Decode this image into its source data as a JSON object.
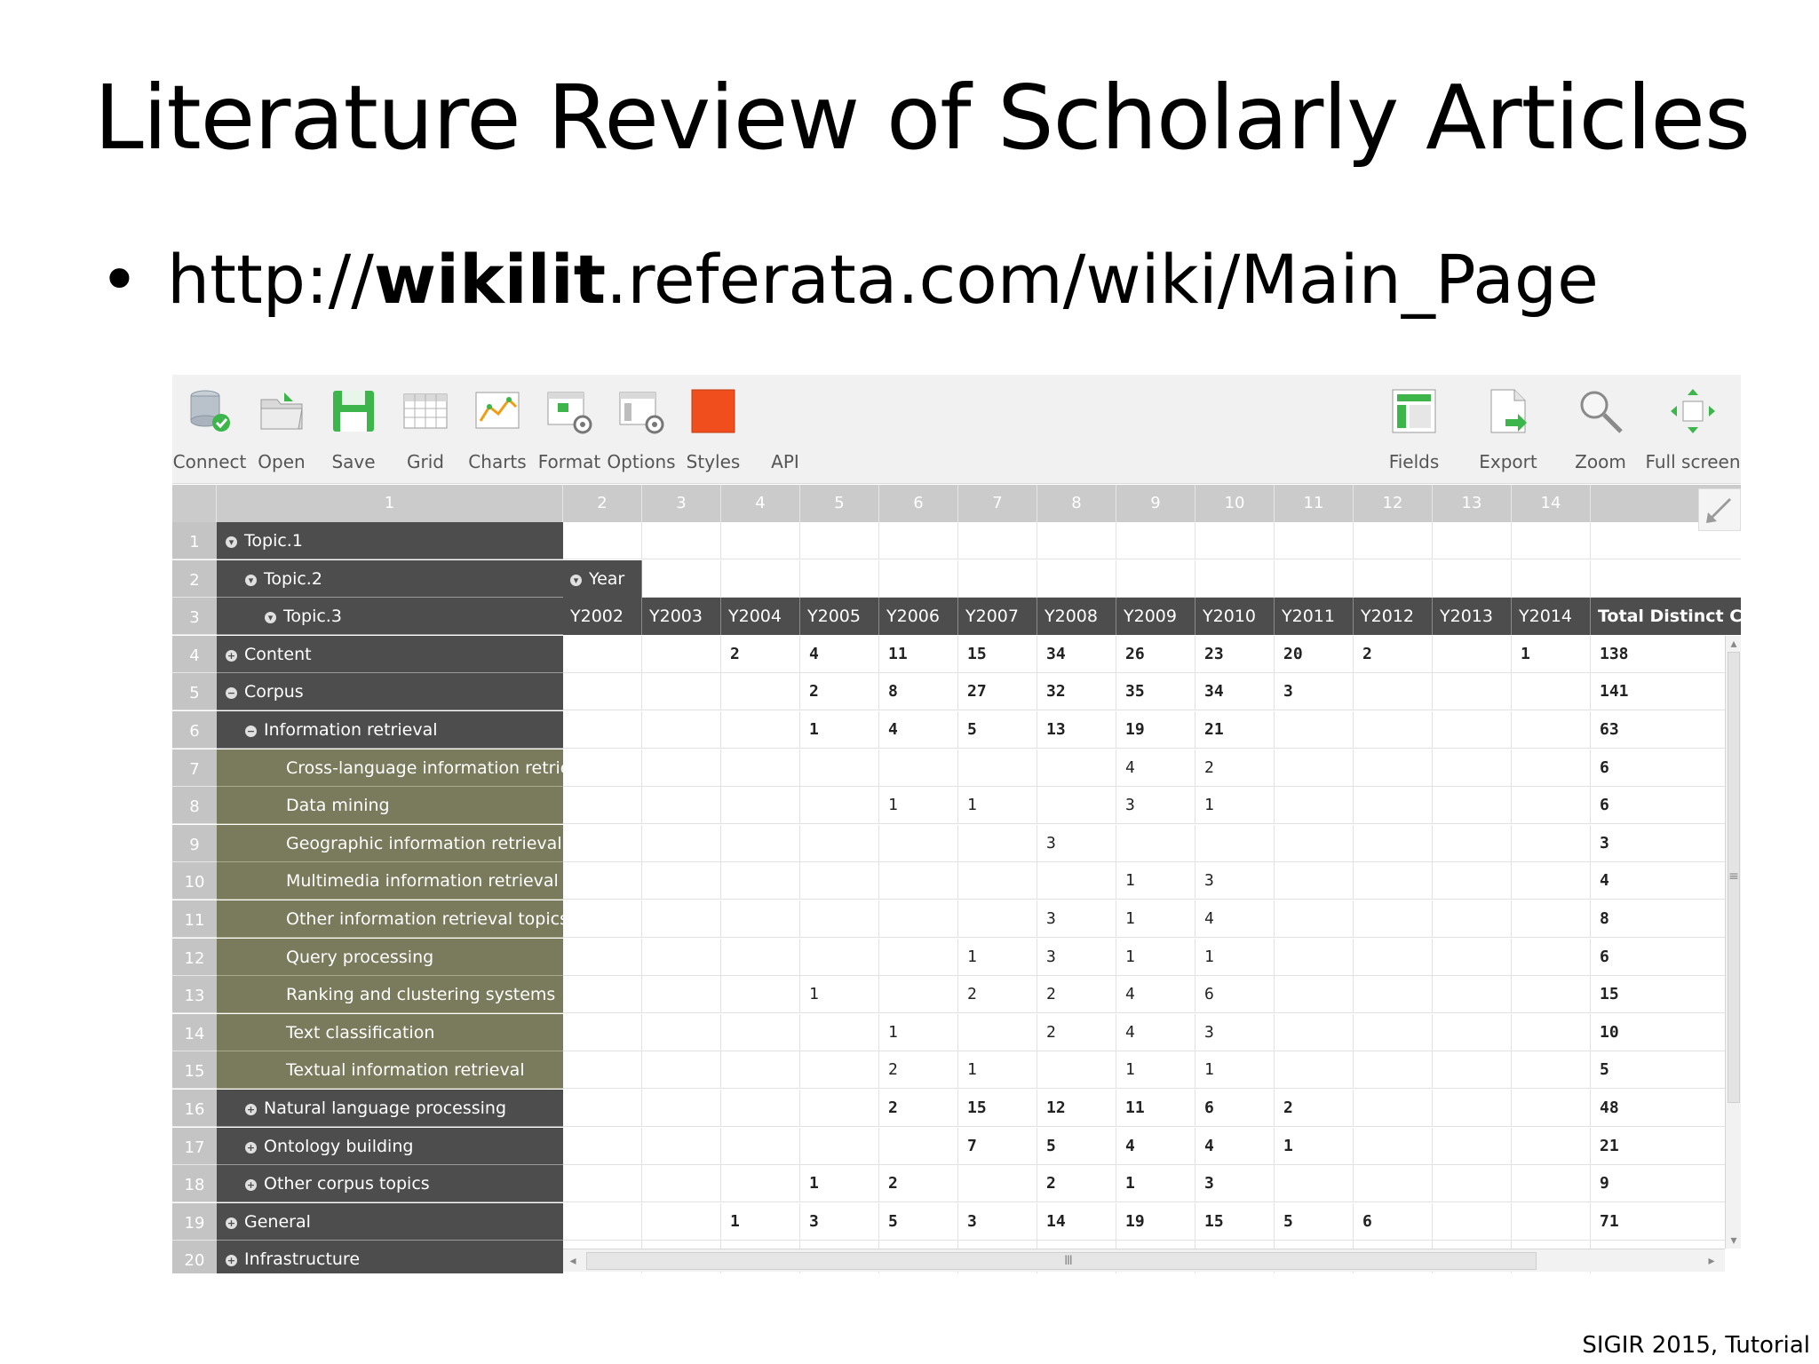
{
  "slide": {
    "title": "Literature Review of Scholarly Articles",
    "bullet": "•",
    "url_prefix": "http://",
    "url_bold": "wikilit",
    "url_suffix": ".referata.com/wiki/Main_Page",
    "footer": "SIGIR 2015, Tutorial"
  },
  "toolbar": {
    "left": [
      {
        "label": "Connect",
        "icon": "database-connect-icon"
      },
      {
        "label": "Open",
        "icon": "folder-open-icon"
      },
      {
        "label": "Save",
        "icon": "floppy-save-icon"
      },
      {
        "label": "Grid",
        "icon": "grid-icon"
      },
      {
        "label": "Charts",
        "icon": "line-chart-icon"
      },
      {
        "label": "Format",
        "icon": "format-cells-icon"
      },
      {
        "label": "Options",
        "icon": "options-gear-icon"
      },
      {
        "label": "Styles",
        "icon": "styles-swatch-icon"
      },
      {
        "label": "API",
        "icon": ""
      }
    ],
    "right": [
      {
        "label": "Fields",
        "icon": "fields-layout-icon"
      },
      {
        "label": "Export",
        "icon": "export-document-icon"
      },
      {
        "label": "Zoom",
        "icon": "magnifier-zoom-icon"
      },
      {
        "label": "Full screen",
        "icon": "fullscreen-arrows-icon"
      }
    ]
  },
  "grid": {
    "column_numbers": [
      "1",
      "2",
      "3",
      "4",
      "5",
      "6",
      "7",
      "8",
      "9",
      "10",
      "11",
      "12",
      "13",
      "14"
    ],
    "hierarchy_labels": [
      "Topic.1",
      "Topic.2",
      "Topic.3"
    ],
    "year_field": "Year",
    "years": [
      "Y2002",
      "Y2003",
      "Y2004",
      "Y2005",
      "Y2006",
      "Y2007",
      "Y2008",
      "Y2009",
      "Y2010",
      "Y2011",
      "Y2012",
      "Y2013",
      "Y2014"
    ],
    "total_header": "Total Distinct Cou",
    "rows": [
      {
        "n": "4",
        "label": "Content",
        "level": 0,
        "icon": "+",
        "style": "dark",
        "bold": true,
        "vals": [
          "",
          "",
          "2",
          "4",
          "11",
          "15",
          "34",
          "26",
          "23",
          "20",
          "2",
          "",
          "1"
        ],
        "total": "138"
      },
      {
        "n": "5",
        "label": "Corpus",
        "level": 0,
        "icon": "−",
        "style": "dark",
        "bold": true,
        "vals": [
          "",
          "",
          "",
          "2",
          "8",
          "27",
          "32",
          "35",
          "34",
          "3",
          "",
          "",
          ""
        ],
        "total": "141"
      },
      {
        "n": "6",
        "label": "Information retrieval",
        "level": 1,
        "icon": "−",
        "style": "dark",
        "bold": true,
        "vals": [
          "",
          "",
          "",
          "1",
          "4",
          "5",
          "13",
          "19",
          "21",
          "",
          "",
          "",
          ""
        ],
        "total": "63"
      },
      {
        "n": "7",
        "label": "Cross-language information retrieval",
        "level": 2,
        "icon": "",
        "style": "olive",
        "bold": false,
        "vals": [
          "",
          "",
          "",
          "",
          "",
          "",
          "",
          "4",
          "2",
          "",
          "",
          "",
          ""
        ],
        "total": "6"
      },
      {
        "n": "8",
        "label": "Data mining",
        "level": 2,
        "icon": "",
        "style": "olive",
        "bold": false,
        "vals": [
          "",
          "",
          "",
          "",
          "1",
          "1",
          "",
          "3",
          "1",
          "",
          "",
          "",
          ""
        ],
        "total": "6"
      },
      {
        "n": "9",
        "label": "Geographic information retrieval",
        "level": 2,
        "icon": "",
        "style": "olive",
        "bold": false,
        "vals": [
          "",
          "",
          "",
          "",
          "",
          "",
          "3",
          "",
          "",
          "",
          "",
          "",
          ""
        ],
        "total": "3"
      },
      {
        "n": "10",
        "label": "Multimedia information retrieval",
        "level": 2,
        "icon": "",
        "style": "olive",
        "bold": false,
        "vals": [
          "",
          "",
          "",
          "",
          "",
          "",
          "",
          "1",
          "3",
          "",
          "",
          "",
          ""
        ],
        "total": "4"
      },
      {
        "n": "11",
        "label": "Other information retrieval topics",
        "level": 2,
        "icon": "",
        "style": "olive",
        "bold": false,
        "vals": [
          "",
          "",
          "",
          "",
          "",
          "",
          "3",
          "1",
          "4",
          "",
          "",
          "",
          ""
        ],
        "total": "8"
      },
      {
        "n": "12",
        "label": "Query processing",
        "level": 2,
        "icon": "",
        "style": "olive",
        "bold": false,
        "vals": [
          "",
          "",
          "",
          "",
          "",
          "1",
          "3",
          "1",
          "1",
          "",
          "",
          "",
          ""
        ],
        "total": "6"
      },
      {
        "n": "13",
        "label": "Ranking and clustering systems",
        "level": 2,
        "icon": "",
        "style": "olive",
        "bold": false,
        "vals": [
          "",
          "",
          "",
          "1",
          "",
          "2",
          "2",
          "4",
          "6",
          "",
          "",
          "",
          ""
        ],
        "total": "15"
      },
      {
        "n": "14",
        "label": "Text classification",
        "level": 2,
        "icon": "",
        "style": "olive",
        "bold": false,
        "vals": [
          "",
          "",
          "",
          "",
          "1",
          "",
          "2",
          "4",
          "3",
          "",
          "",
          "",
          ""
        ],
        "total": "10"
      },
      {
        "n": "15",
        "label": "Textual information retrieval",
        "level": 2,
        "icon": "",
        "style": "olive",
        "bold": false,
        "vals": [
          "",
          "",
          "",
          "",
          "2",
          "1",
          "",
          "1",
          "1",
          "",
          "",
          "",
          ""
        ],
        "total": "5"
      },
      {
        "n": "16",
        "label": "Natural language processing",
        "level": 1,
        "icon": "+",
        "style": "dark",
        "bold": true,
        "vals": [
          "",
          "",
          "",
          "",
          "2",
          "15",
          "12",
          "11",
          "6",
          "2",
          "",
          "",
          ""
        ],
        "total": "48"
      },
      {
        "n": "17",
        "label": "Ontology building",
        "level": 1,
        "icon": "+",
        "style": "dark",
        "bold": true,
        "vals": [
          "",
          "",
          "",
          "",
          "",
          "7",
          "5",
          "4",
          "4",
          "1",
          "",
          "",
          ""
        ],
        "total": "21"
      },
      {
        "n": "18",
        "label": "Other corpus topics",
        "level": 1,
        "icon": "+",
        "style": "dark",
        "bold": true,
        "vals": [
          "",
          "",
          "",
          "1",
          "2",
          "",
          "2",
          "1",
          "3",
          "",
          "",
          "",
          ""
        ],
        "total": "9"
      },
      {
        "n": "19",
        "label": "General",
        "level": 0,
        "icon": "+",
        "style": "dark",
        "bold": true,
        "vals": [
          "",
          "",
          "1",
          "3",
          "5",
          "3",
          "14",
          "19",
          "15",
          "5",
          "6",
          "",
          ""
        ],
        "total": "71"
      },
      {
        "n": "20",
        "label": "Infrastructure",
        "level": 0,
        "icon": "+",
        "style": "dark",
        "bold": true,
        "vals": [
          "",
          "",
          "",
          "",
          "",
          "",
          "",
          "",
          "",
          "",
          "",
          "",
          ""
        ],
        "total": ""
      }
    ]
  },
  "colors": {
    "row_header_dark": "#4d4d4d",
    "row_header_selected": "#7a7a5c",
    "styles_swatch": "#f04e1c",
    "save_green": "#3cb54a"
  }
}
